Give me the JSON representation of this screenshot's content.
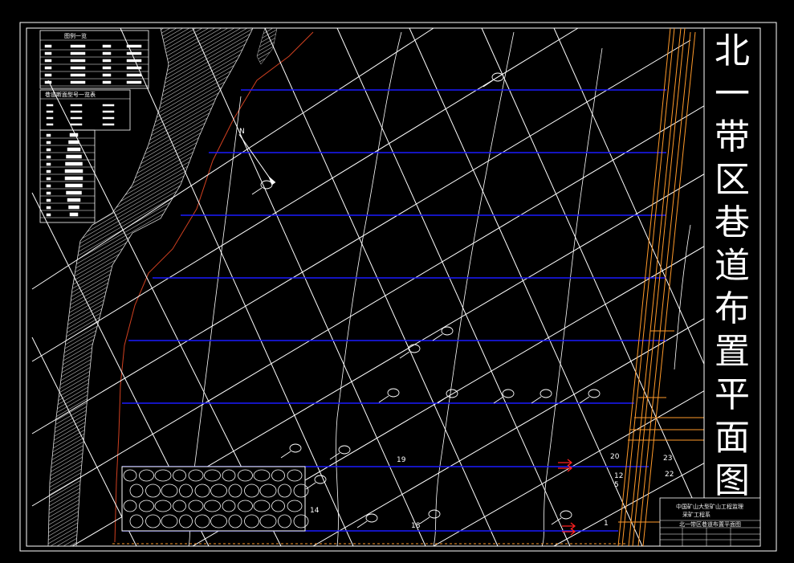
{
  "drawing": {
    "vertical_title_chars": [
      "北",
      "一",
      "带",
      "区",
      "巷",
      "道",
      "布",
      "置",
      "平",
      "面",
      "图"
    ],
    "legend": {
      "title": "图例一览",
      "subtitle": "巷道断面型号一览表"
    },
    "title_block": {
      "project_line1": "中国矿山大型矿山工程监理",
      "project_line2": "采矿工程系",
      "drawing_name": "北一带区巷道布置平面图"
    },
    "compass_letter": "N",
    "labels": {
      "l19": "19",
      "l20": "20",
      "l23": "23",
      "l22": "22",
      "l12": "12",
      "l5": "5",
      "l14": "14",
      "l18": "18",
      "l1": "1"
    },
    "colors": {
      "background": "#000000",
      "grid": "#ffffff",
      "roadway": "#1a1aff",
      "shaft": "#ff9a2a",
      "boundary": "#d04020"
    }
  }
}
